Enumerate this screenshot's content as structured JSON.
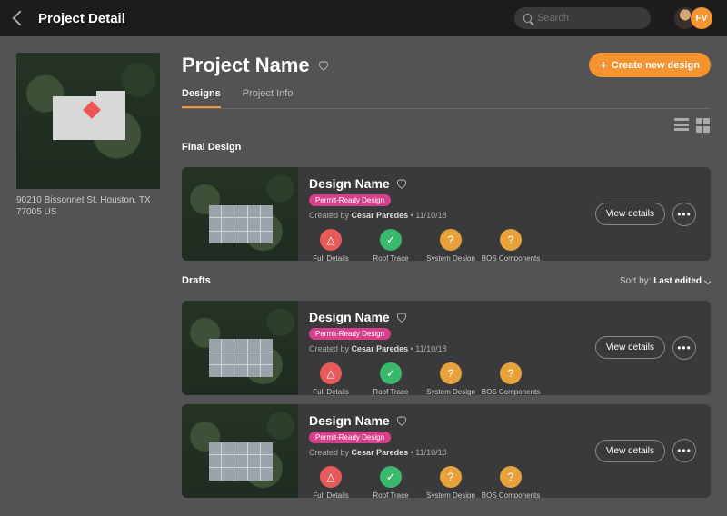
{
  "topbar": {
    "title": "Project Detail",
    "search_placeholder": "Search",
    "avatar_initials": "FV"
  },
  "sidebar": {
    "address": "90210 Bissonnet St, Houston, TX 77005 US"
  },
  "project": {
    "name": "Project Name",
    "create_button": "Create new design"
  },
  "tabs": [
    {
      "label": "Designs",
      "active": true
    },
    {
      "label": "Project Info",
      "active": false
    }
  ],
  "sections": {
    "final": {
      "title": "Final Design"
    },
    "drafts": {
      "title": "Drafts",
      "sort_label": "Sort by:",
      "sort_value": "Last edited"
    }
  },
  "design_card": {
    "title": "Design Name",
    "badge": "Permit-Ready Design",
    "created_prefix": "Created by",
    "created_author": "Cesar Paredes",
    "created_date": "11/10/18",
    "view_button": "View details",
    "statuses": [
      {
        "label": "Full Details",
        "color": "red",
        "icon": "alert"
      },
      {
        "label": "Roof Trace",
        "color": "green",
        "icon": "check"
      },
      {
        "label": "System Design",
        "color": "orange",
        "icon": "question"
      },
      {
        "label": "BOS Components",
        "color": "orange",
        "icon": "question"
      }
    ]
  }
}
